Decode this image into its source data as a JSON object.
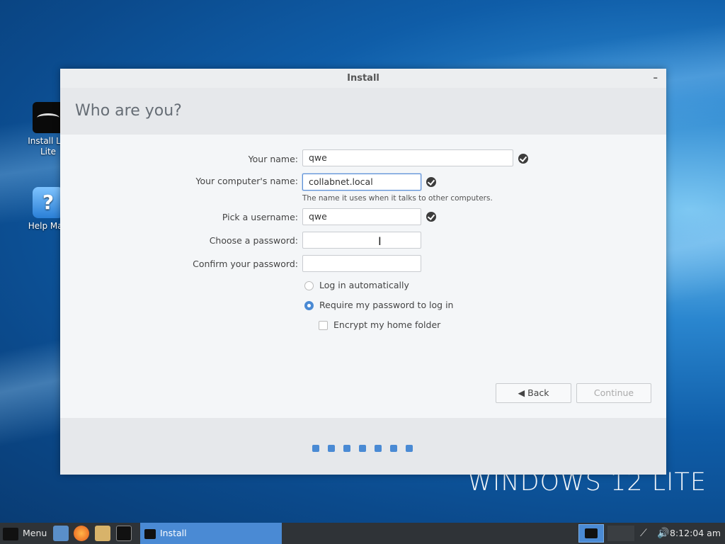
{
  "desktop": {
    "brand": "WINDOWS 12 LITE",
    "icons": [
      {
        "label": "Install Lin\nLite",
        "icon": "install-icon"
      },
      {
        "label": "Help Man",
        "icon": "help-icon"
      }
    ]
  },
  "window": {
    "title": "Install",
    "minimize": "–",
    "heading": "Who are you?",
    "form": {
      "name_label": "Your name:",
      "name_value": "qwe",
      "computer_label": "Your computer's name:",
      "computer_value": "collabnet.local",
      "computer_hint": "The name it uses when it talks to other computers.",
      "username_label": "Pick a username:",
      "username_value": "qwe",
      "password_label": "Choose a password:",
      "password_value": "",
      "confirm_label": "Confirm your password:",
      "confirm_value": "",
      "login_auto": "Log in automatically",
      "login_require": "Require my password to log in",
      "encrypt": "Encrypt my home folder"
    },
    "buttons": {
      "back": "◀ Back",
      "continue": "Continue"
    },
    "progress": {
      "steps": 7
    }
  },
  "taskbar": {
    "menu_label": "Menu",
    "task_label": "Install",
    "clock": "8:12:04 am"
  }
}
